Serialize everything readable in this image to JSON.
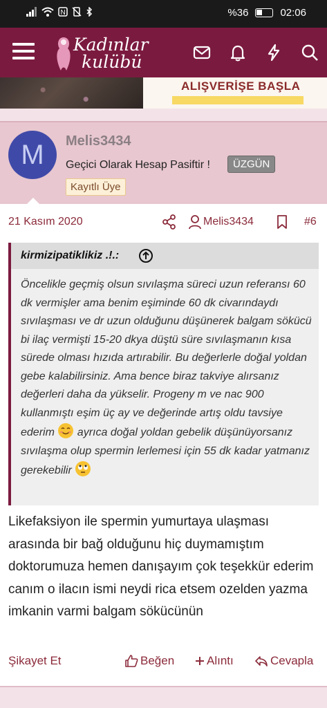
{
  "status_bar": {
    "battery_text": "%36",
    "time": "02:06"
  },
  "app_bar": {
    "logo_line1": "Kadınlar",
    "logo_line2": "kulübü"
  },
  "banner": {
    "text": "ALIŞVERİŞE BAŞLA"
  },
  "user": {
    "avatar_letter": "M",
    "name": "Melis3434",
    "title": "Geçici Olarak Hesap Pasiftir !",
    "badge": "ÜZGÜN",
    "rank": "Kayıtlı Üye"
  },
  "post": {
    "date": "21 Kasım 2020",
    "author": "Melis3434",
    "number": "#6",
    "quote": {
      "author": "kirmizipatiklikiz .!.:",
      "text_part1": "Öncelikle geçmiş olsun sıvılaşma süreci uzun referansı 60 dk vermişler ama benim eşiminde 60 dk civarındaydı sıvılaşması ve dr uzun olduğunu düşünerek balgam sökücü bi ilaç vermişti 15-20 dkya düştü süre sıvılaşmanın kısa sürede olması hızıda artırabilir. Bu değerlerle doğal yoldan gebe kalabilirsiniz. Ama bence biraz takviye alırsanız değerleri daha da yükselir. Progeny m ve nac 900 kullanmıştı eşim üç ay ve değerinde artış oldu tavsiye ederim",
      "text_part2": " ayrıca doğal yoldan gebelik düşünüyorsanız sıvılaşma olup spermin lerlemesi için 55 dk kadar yatmanız gerekebilir"
    },
    "message": "Likefaksiyon ile spermin yumurtaya ulaşması arasında bir bağ olduğunu hiç duymamıştım doktorumuza hemen danışayım çok teşekkür ederim canım o ilacın ismi neydi rica etsem ozelden yazma imkanin varmi balgam sökücünün",
    "actions": {
      "report": "Şikayet Et",
      "like": "Beğen",
      "quote": "Alıntı",
      "reply": "Cevapla"
    }
  },
  "colors": {
    "brand": "#7b1a3f",
    "user_bg": "#e8c7d0",
    "avatar": "#3f4aa8",
    "link": "#8b2a3a"
  }
}
